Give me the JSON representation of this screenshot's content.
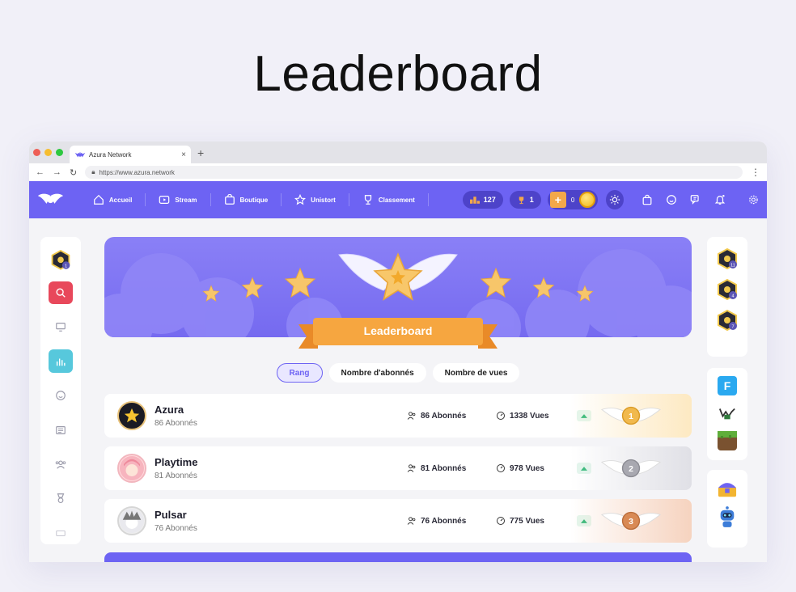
{
  "page_title": "Leaderboard",
  "browser": {
    "tab_title": "Azura Network",
    "url": "https://www.azura.network"
  },
  "nav": {
    "items": [
      {
        "label": "Accueil",
        "icon": "home-icon"
      },
      {
        "label": "Stream",
        "icon": "play-icon"
      },
      {
        "label": "Boutique",
        "icon": "bag-icon"
      },
      {
        "label": "Unistort",
        "icon": "star-icon"
      },
      {
        "label": "Classement",
        "icon": "trophy-icon"
      }
    ],
    "rank_value": "127",
    "trophy_value": "1",
    "coins_value": "0"
  },
  "banner": {
    "ribbon_label": "Leaderboard"
  },
  "tabs": [
    {
      "label": "Rang",
      "active": true
    },
    {
      "label": "Nombre d'abonnés",
      "active": false
    },
    {
      "label": "Nombre de vues",
      "active": false
    }
  ],
  "rows": [
    {
      "name": "Azura",
      "subtitle": "86 Abonnés",
      "followers": "86 Abonnés",
      "views": "1338 Vues",
      "rank": "1",
      "medal_color": "#f1b94d",
      "bg": "#fdf2dc"
    },
    {
      "name": "Playtime",
      "subtitle": "81 Abonnés",
      "followers": "81 Abonnés",
      "views": "978 Vues",
      "rank": "2",
      "medal_color": "#a8a8b0",
      "bg": "#ececf0"
    },
    {
      "name": "Pulsar",
      "subtitle": "76 Abonnés",
      "followers": "76 Abonnés",
      "views": "775 Vues",
      "rank": "3",
      "medal_color": "#d98a55",
      "bg": "#f8e2d4"
    }
  ],
  "colors": {
    "brand": "#6d63f3",
    "accent_orange": "#f3a84a",
    "trend_green": "#2bb673"
  },
  "sidebar_badges": {
    "left_level": "1",
    "right_levels": [
      "11",
      "4",
      "7"
    ]
  }
}
